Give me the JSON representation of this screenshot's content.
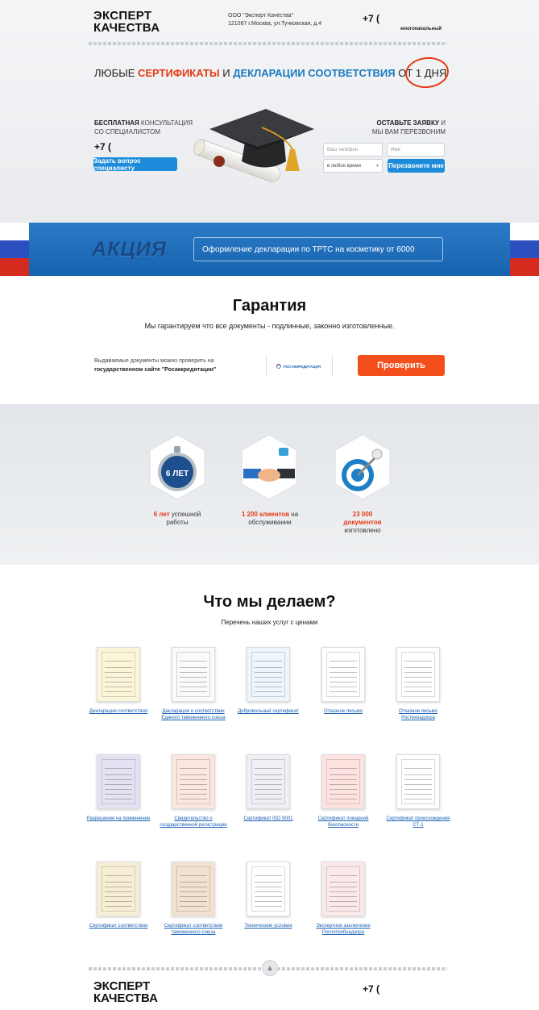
{
  "header": {
    "logo_line1": "ЭКСПЕРТ",
    "logo_line2": "КАЧЕСТВА",
    "company_line1": "ООО \"Эксперт Качества\"",
    "company_line2": "121087 г.Москва, ул.Тучковская, д.4",
    "phone": "+7 (",
    "multichannel": "многоканальный"
  },
  "hero": {
    "tagline_part1": "ЛЮБЫЕ ",
    "tagline_certs": "СЕРТИФИКАТЫ",
    "tagline_part2": " И ",
    "tagline_decl": "ДЕКЛАРАЦИИ СООТВЕТСТВИЯ",
    "tagline_part3": " ОТ ",
    "tagline_days": "1 ДНЯ",
    "consult_bold": "БЕСПЛАТНАЯ",
    "consult_line1_rest": " КОНСУЛЬТАЦИЯ",
    "consult_line2": "СО СПЕЦИАЛИСТОМ",
    "phone": "+7 (",
    "ask_button": "Задать вопрос специалисту",
    "callback_bold": "ОСТАВЬТЕ ЗАЯВКУ",
    "callback_line1_rest": " И",
    "callback_line2": "МЫ ВАМ ПЕРЕЗВОНИМ",
    "phone_placeholder": "Ваш телефон",
    "name_placeholder": "Имя",
    "time_select": "в любое время",
    "callback_button": "Перезвоните мне"
  },
  "promo": {
    "badge": "АКЦИЯ",
    "text": "Оформление декларации по ТРТС на косметику от 6000"
  },
  "guarantee": {
    "title": "Гарантия",
    "subtitle": "Мы гарантируем что все документы - подлинные, законно изготовленные.",
    "check_line1": "Выдаваемые документы можно проверить на",
    "check_line2": "государственном сайте \"Росаккредитации\"",
    "logo_text": "РОСАККРЕДИТАЦИЯ",
    "check_button": "Проверить"
  },
  "stats": [
    {
      "badge": "6 ЛЕТ",
      "highlight": "6 лет",
      "text_rest": " успешной",
      "line2": "работы"
    },
    {
      "highlight": "1 200 клиентов",
      "text_rest": " на",
      "line2": "обслуживании"
    },
    {
      "highlight": "23 000",
      "line_b": "документов",
      "line2": "изготовлено"
    }
  ],
  "services": {
    "title": "Что мы делаем?",
    "subtitle": "Перечень наших услуг с ценами",
    "items": [
      {
        "label": "Декларация соответствия"
      },
      {
        "label": "Декларация о соответствии Единого таможенного союза"
      },
      {
        "label": "Добровольный сертификат"
      },
      {
        "label": "Отказное письмо"
      },
      {
        "label": "Отказное письмо Ростехнадзора"
      },
      {
        "label": "Разрешение на применение"
      },
      {
        "label": "Свидетельство о государственной регистрации"
      },
      {
        "label": "Сертификат ISO 9001"
      },
      {
        "label": "Сертификат пожарной безопасности"
      },
      {
        "label": "Сертификат происхождения СТ-1"
      },
      {
        "label": "Сертификат соответствия"
      },
      {
        "label": "Сертификат соответствия таможенного союза"
      },
      {
        "label": "Технические условия"
      },
      {
        "label": "Экспертное заключение Роспотребнадзора"
      }
    ]
  },
  "footer": {
    "logo_line1": "ЭКСПЕРТ",
    "logo_line2": "КАЧЕСТВА",
    "phone": "+7 ("
  },
  "colors": {
    "accent_red": "#e43b14",
    "accent_blue": "#1b7ac2",
    "button_orange": "#f24f1d",
    "button_blue": "#1d8bd9"
  }
}
